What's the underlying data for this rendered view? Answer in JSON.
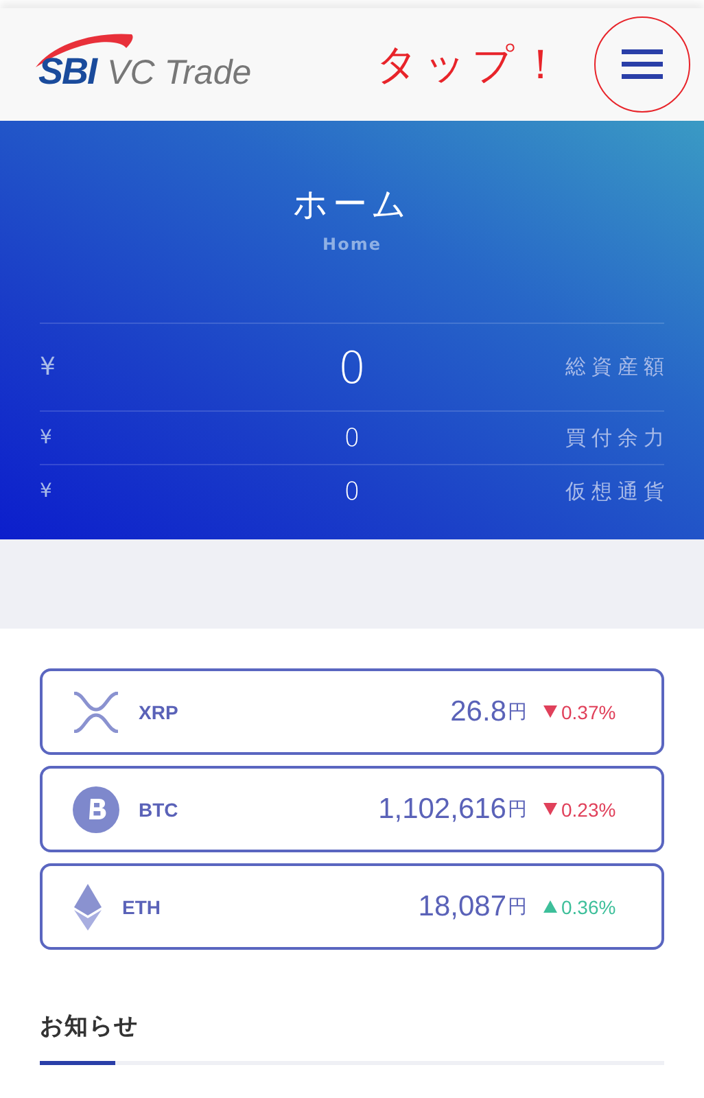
{
  "header": {
    "logo_mark": "SBI",
    "logo_text": "VC Trade",
    "annotation": "タップ！"
  },
  "hero": {
    "title": "ホーム",
    "subtitle": "Home",
    "balances": [
      {
        "kind": "total",
        "currency": "¥",
        "value": "0",
        "label": "総資産額"
      },
      {
        "kind": "sub",
        "currency": "¥",
        "value": "0",
        "label": "買付余力"
      },
      {
        "kind": "sub",
        "currency": "¥",
        "value": "0",
        "label": "仮想通貨"
      }
    ]
  },
  "coins": [
    {
      "kind": "xrp",
      "symbol": "XRP",
      "price": "26.8",
      "unit": "円",
      "falling": true,
      "change": "0.37%"
    },
    {
      "kind": "btc",
      "symbol": "BTC",
      "price": "1,102,616",
      "unit": "円",
      "falling": true,
      "change": "0.23%"
    },
    {
      "kind": "eth",
      "symbol": "ETH",
      "price": "18,087",
      "unit": "円",
      "falling": false,
      "change": "0.36%"
    }
  ],
  "news": {
    "title": "お知らせ",
    "level": 0.12
  }
}
